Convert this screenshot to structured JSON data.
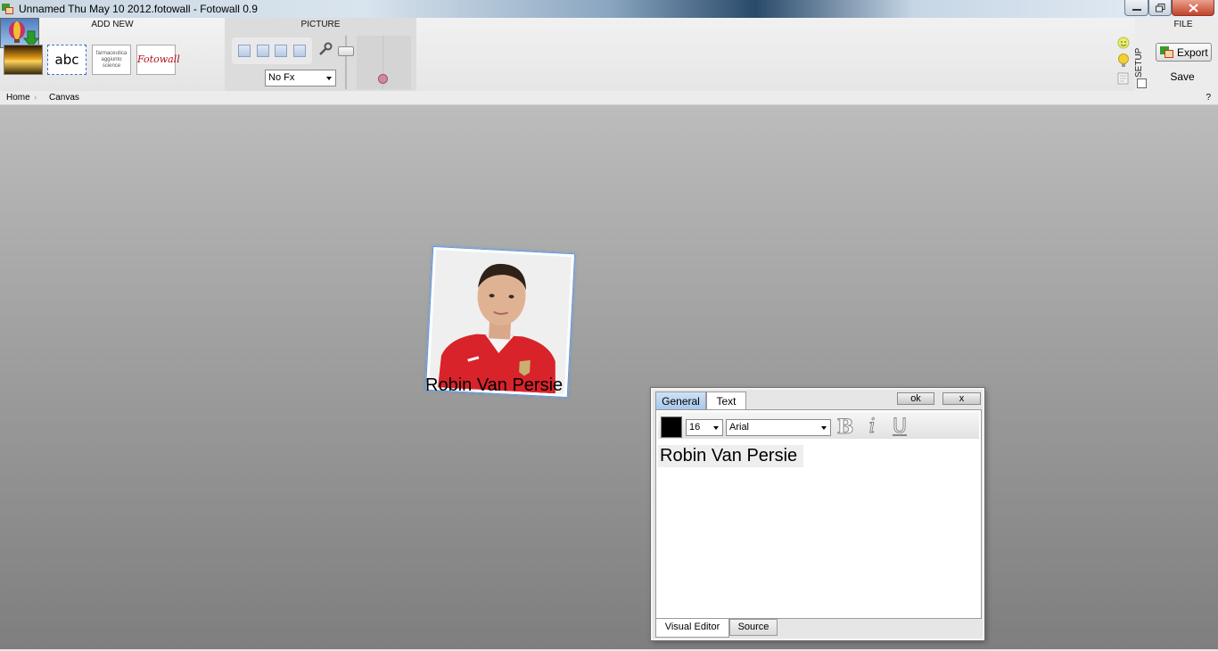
{
  "window": {
    "title": "Unnamed Thu May 10 2012.fotowall - Fotowall 0.9"
  },
  "ribbon": {
    "add_new_label": "ADD NEW",
    "picture_label": "PICTURE",
    "file_label": "FILE",
    "setup_label": "SETUP",
    "add_items": [
      "add-picture",
      "add-text",
      "add-wordcloud",
      "add-fotowall",
      "add-download"
    ],
    "add_text_glyph": "abc",
    "wordcloud_words": "farmaceutica aggiunto science",
    "fotowall_logo_text": "Fotowall",
    "fx_selected": "No Fx",
    "export_label": "Export",
    "save_label": "Save"
  },
  "breadcrumb": {
    "home": "Home",
    "separator": "›",
    "canvas": "Canvas",
    "help": "?"
  },
  "canvas": {
    "photo_caption": "Robin Van Persie"
  },
  "editor": {
    "tabs": {
      "general": "General",
      "text": "Text"
    },
    "ok_label": "ok",
    "close_label": "x",
    "font_size": "16",
    "font_family": "Arial",
    "bold_glyph": "B",
    "italic_glyph": "i",
    "underline_glyph": "U",
    "text_content": "Robin Van Persie",
    "text_color": "#000000",
    "bottom_tabs": {
      "visual": "Visual Editor",
      "source": "Source"
    }
  }
}
